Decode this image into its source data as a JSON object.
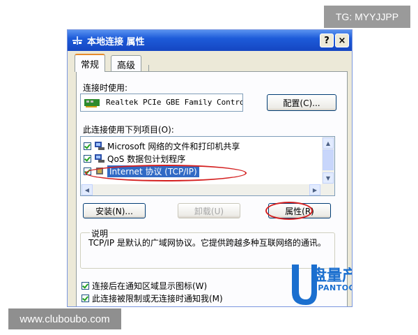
{
  "watermarks": {
    "top": "TG: MYYJJPP",
    "bottom": "www.cluboubo.com"
  },
  "window": {
    "title": "本地连接 属性",
    "help_label": "?",
    "close_label": "×"
  },
  "tabs": [
    {
      "label": "常规",
      "active": true
    },
    {
      "label": "高级",
      "active": false
    }
  ],
  "connect_using": {
    "label": "连接时使用:",
    "adapter": "Realtek PCIe GBE Family Contro",
    "configure_button": "配置(C)..."
  },
  "items_section": {
    "label": "此连接使用下列项目(O):",
    "items": [
      {
        "label": "Microsoft 网络的文件和打印机共享",
        "checked": true
      },
      {
        "label": "QoS 数据包计划程序",
        "checked": true
      },
      {
        "label": "Internet 协议 (TCP/IP)",
        "checked": true,
        "selected": true
      }
    ]
  },
  "buttons": {
    "install": "安装(N)...",
    "uninstall": "卸载(U)",
    "properties": "属性(R)"
  },
  "description": {
    "title": "说明",
    "text": "TCP/IP 是默认的广域网协议。它提供跨越多种互联网络的通讯。"
  },
  "options": [
    {
      "label": "连接后在通知区域显示图标(W)",
      "checked": true
    },
    {
      "label": "此连接被限制或无连接时通知我(M)",
      "checked": true
    }
  ],
  "brand": {
    "name": "盘量产网",
    "domain": "UPANTOOL.COM"
  },
  "colors": {
    "titlebar": "#1d5bd9",
    "selection": "#316ac5",
    "annotation": "#d42020",
    "brand": "#1b6fcf"
  }
}
